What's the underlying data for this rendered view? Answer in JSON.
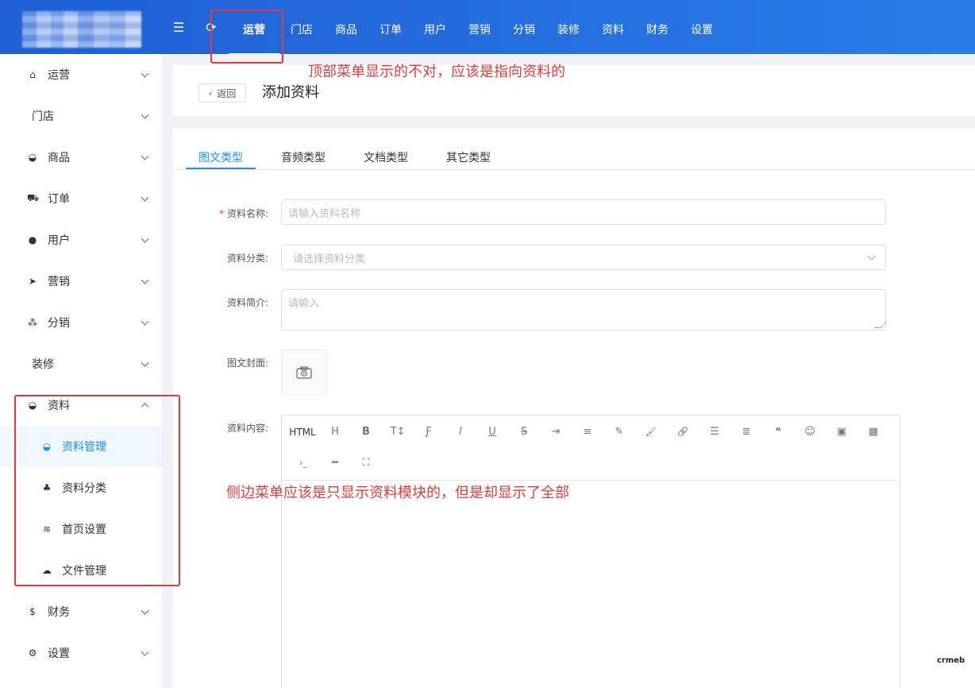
{
  "topnav": {
    "items": [
      "运营",
      "门店",
      "商品",
      "订单",
      "用户",
      "营销",
      "分销",
      "装修",
      "资料",
      "财务",
      "设置"
    ],
    "active": "运营"
  },
  "sidebar": {
    "items": [
      {
        "label": "运营",
        "icon": "home-icon"
      },
      {
        "label": "门店",
        "icon": ""
      },
      {
        "label": "商品",
        "icon": "basket-icon"
      },
      {
        "label": "订单",
        "icon": "cart-icon"
      },
      {
        "label": "用户",
        "icon": "user-icon"
      },
      {
        "label": "营销",
        "icon": "paper-plane-icon"
      },
      {
        "label": "分销",
        "icon": "group-icon"
      },
      {
        "label": "装修",
        "icon": ""
      },
      {
        "label": "资料",
        "icon": "basket-icon",
        "expanded": true
      },
      {
        "label": "财务",
        "icon": "dollar-icon"
      },
      {
        "label": "设置",
        "icon": "gear-icon"
      }
    ],
    "subitems": [
      {
        "label": "资料管理",
        "icon": "basket-icon",
        "active": true
      },
      {
        "label": "资料分类",
        "icon": "cluster-icon"
      },
      {
        "label": "首页设置",
        "icon": "layers-icon"
      },
      {
        "label": "文件管理",
        "icon": "cloud-icon"
      }
    ]
  },
  "header": {
    "back_label": "返回",
    "title": "添加资料"
  },
  "tabs": [
    "图文类型",
    "音频类型",
    "文档类型",
    "其它类型"
  ],
  "form": {
    "name_label": "资料名称:",
    "name_placeholder": "请输入资料名称",
    "category_label": "资料分类:",
    "category_placeholder": "请选择资料分类",
    "intro_label": "资料简介:",
    "intro_placeholder": "请输入",
    "cover_label": "图文封面:",
    "content_label": "资料内容:"
  },
  "editor": {
    "html_label": "HTML",
    "buttons": [
      "H",
      "B",
      "T↕",
      "Ƒ",
      "I",
      "U",
      "S",
      "⇥",
      "≡",
      "✎",
      "🖌",
      "🔗",
      "☰",
      "≣",
      "❝",
      "☺",
      "▣",
      "▦",
      "›_",
      "━",
      "⛶"
    ]
  },
  "annotations": {
    "top": "顶部菜单显示的不对，应该是指向资料的",
    "side": "侧边菜单应该是只显示资料模块的，但是却显示了全部"
  },
  "watermark": "crmeb",
  "colors": {
    "primary": "#1890ff",
    "topbar": "#2a7be8",
    "annotation": "#e53935"
  }
}
